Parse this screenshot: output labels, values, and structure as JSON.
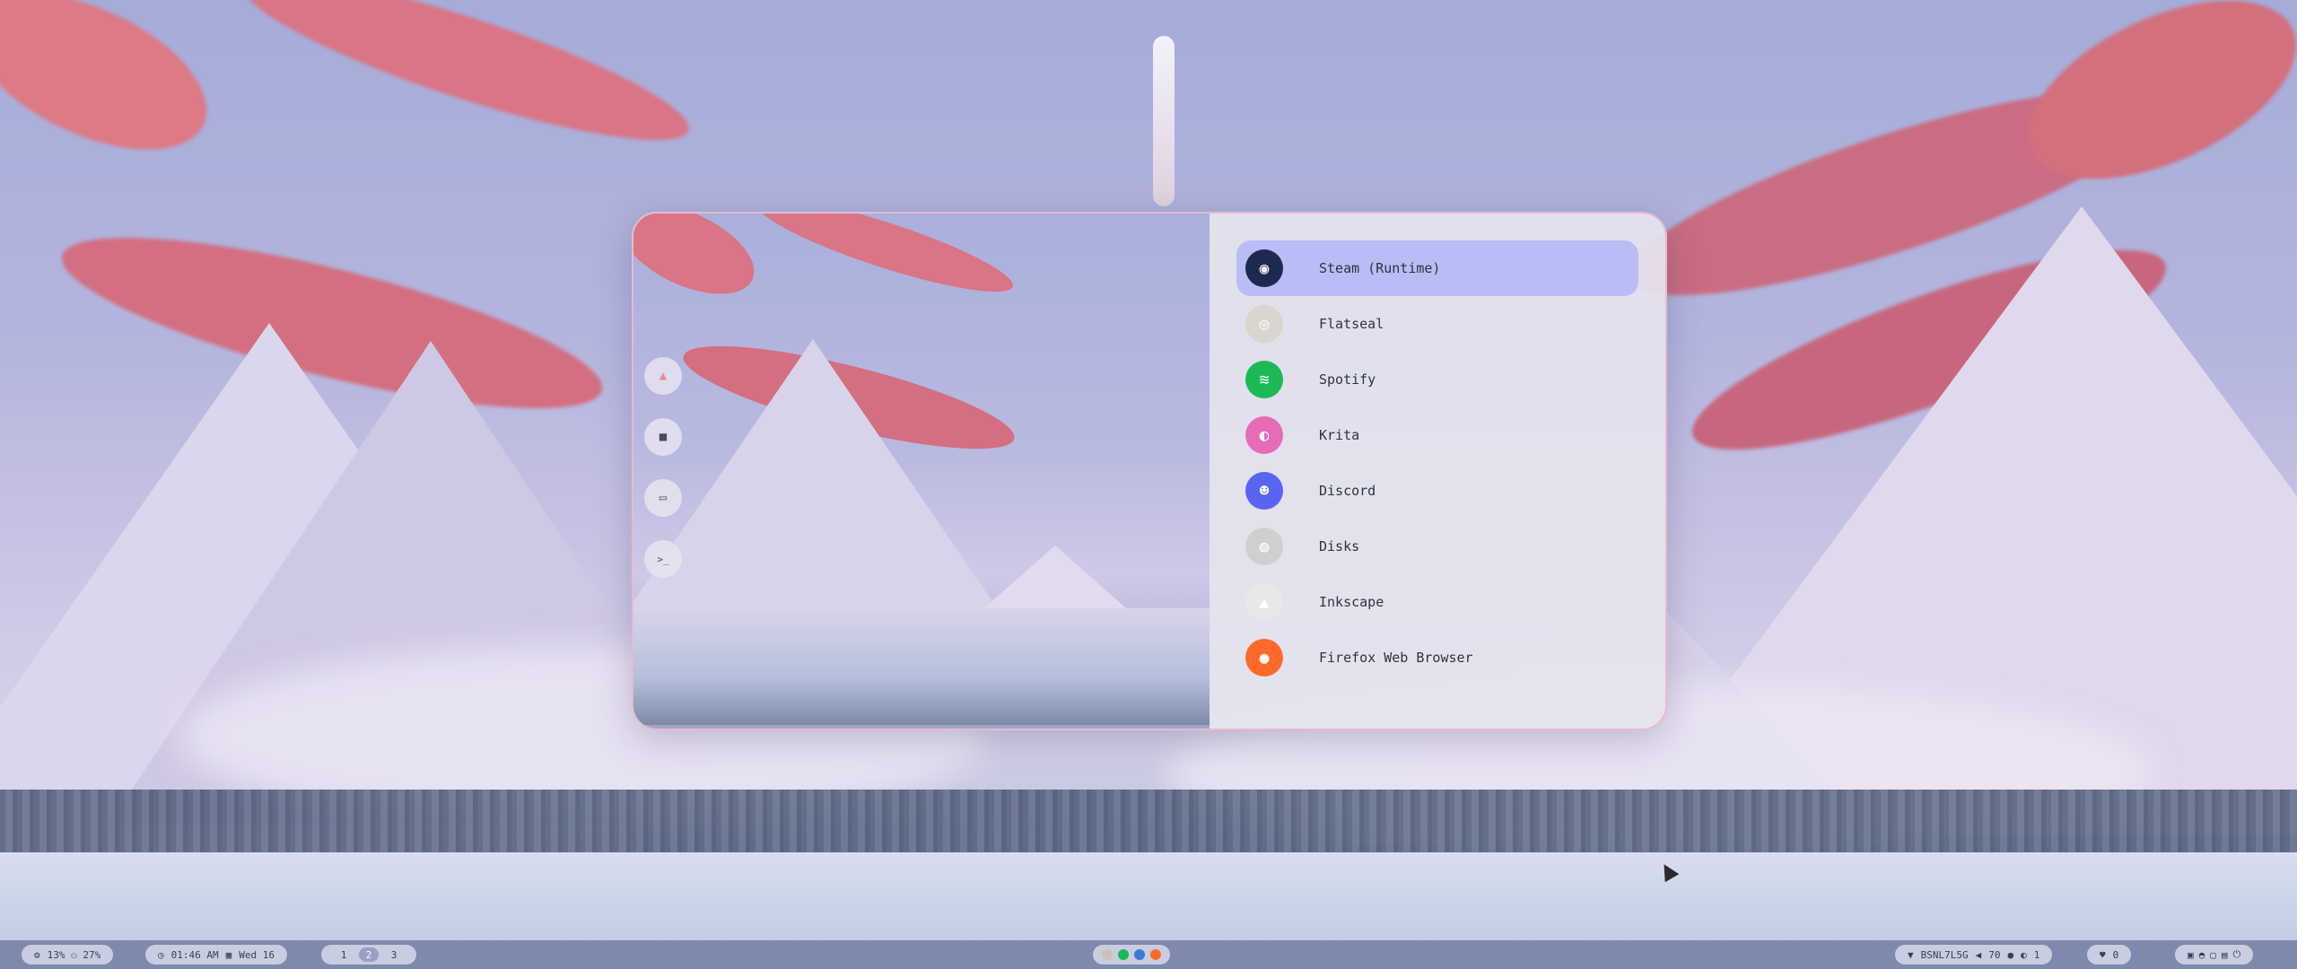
{
  "launcher": {
    "side_buttons": [
      {
        "icon": "arch-logo-icon",
        "glyph": "▲"
      },
      {
        "icon": "folder-icon",
        "glyph": "■"
      },
      {
        "icon": "window-icon",
        "glyph": "▭"
      },
      {
        "icon": "terminal-icon",
        "glyph": ">_"
      }
    ],
    "apps": [
      {
        "label": "Steam (Runtime)",
        "icon": "steam-icon",
        "color": "#1b2a4e",
        "glyph": "◉",
        "selected": true
      },
      {
        "label": "Flatseal",
        "icon": "flatseal-icon",
        "color": "#d9d6cf",
        "glyph": "◎",
        "selected": false
      },
      {
        "label": "Spotify",
        "icon": "spotify-icon",
        "color": "#1db954",
        "glyph": "≋",
        "selected": false
      },
      {
        "label": "Krita",
        "icon": "krita-icon",
        "color": "#e86bb8",
        "glyph": "◐",
        "selected": false
      },
      {
        "label": "Discord",
        "icon": "discord-icon",
        "color": "#5865f2",
        "glyph": "☻",
        "selected": false
      },
      {
        "label": "Disks",
        "icon": "disks-icon",
        "color": "#cfcfcf",
        "glyph": "◍",
        "selected": false
      },
      {
        "label": "Inkscape",
        "icon": "inkscape-icon",
        "color": "#e8e8e8",
        "glyph": "▲",
        "selected": false
      },
      {
        "label": "Firefox Web Browser",
        "icon": "firefox-icon",
        "color": "#ff6a2b",
        "glyph": "●",
        "selected": false
      }
    ]
  },
  "bar": {
    "stats": "13% ⚇ 27%",
    "clock": "01:46 AM",
    "date": "Wed 16",
    "workspaces": [
      "1",
      "2",
      "3"
    ],
    "active_workspace": "2",
    "tray_icons": [
      {
        "icon": "files-icon",
        "color": "#c9c3b5"
      },
      {
        "icon": "spotify-tray-icon",
        "color": "#1db954"
      },
      {
        "icon": "vscode-tray-icon",
        "color": "#3b7bd6"
      },
      {
        "icon": "firefox-tray-icon",
        "color": "#ff6a2b"
      }
    ],
    "wifi": "BSNL7L5G",
    "volume": "70",
    "mic": "1",
    "notifications": "0"
  }
}
